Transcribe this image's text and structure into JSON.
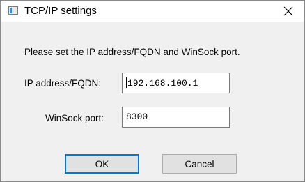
{
  "window": {
    "title": "TCP/IP settings",
    "close_glyph": "×",
    "icon": "app-window-icon"
  },
  "dialog": {
    "instruction": "Please set the IP address/FQDN and WinSock port.",
    "ip_label": "IP address/FQDN:",
    "ip_value": "192.168.100.1",
    "port_label": "WinSock port:",
    "port_value": "8300"
  },
  "buttons": {
    "ok_label": "OK",
    "cancel_label": "Cancel"
  },
  "colors": {
    "accent": "#0078d7",
    "dialog_background": "#f0f0f0"
  }
}
